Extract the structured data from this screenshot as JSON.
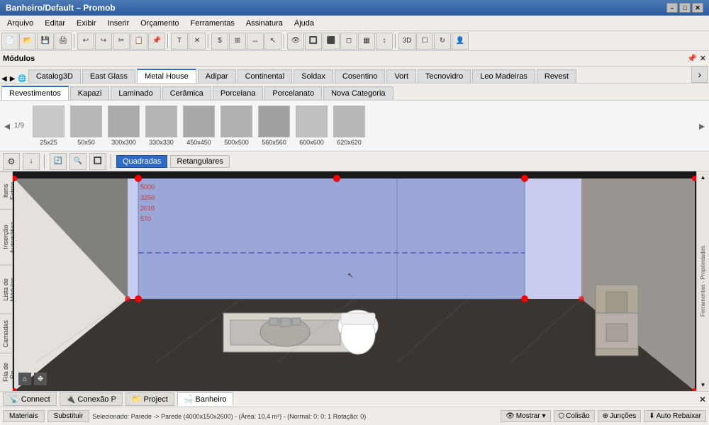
{
  "titleBar": {
    "title": "Banheiro/Default – Promob",
    "buttons": [
      "–",
      "□",
      "✕"
    ]
  },
  "menuBar": {
    "items": [
      "Arquivo",
      "Editar",
      "Exibir",
      "Inserir",
      "Orçamento",
      "Ferramentas",
      "Assinatura",
      "Ajuda"
    ]
  },
  "modulesPanel": {
    "title": "Módulos",
    "pinIcon": "📌",
    "closeIcon": "✕"
  },
  "catalogTabs": {
    "tabs": [
      "Catalog3D",
      "East Glass",
      "Metal House",
      "Adipar",
      "Continental",
      "Soldax",
      "Cosentino",
      "Vort",
      "Tecnovidro",
      "Leo Madeiras",
      "Revest"
    ],
    "activeTab": "Metal House",
    "moreLabel": "›"
  },
  "categoryTabs": {
    "tabs": [
      "Revestimentos",
      "Kapazi",
      "Laminado",
      "Cerâmica",
      "Porcelana",
      "Porcelanato",
      "Nova Categoria"
    ],
    "activeTab": "Revestimentos"
  },
  "tileArea": {
    "pageIndicator": "1/9",
    "tiles": [
      {
        "label": "25x25"
      },
      {
        "label": "50x50"
      },
      {
        "label": "300x300"
      },
      {
        "label": "330x330"
      },
      {
        "label": "450x450"
      },
      {
        "label": "500x500"
      },
      {
        "label": "560x560"
      },
      {
        "label": "600x600"
      },
      {
        "label": "620x620"
      }
    ]
  },
  "filterBar": {
    "buttons": [
      "Quadradas",
      "Retangulares"
    ]
  },
  "verticalTabs": {
    "left": [
      "Itens Extras",
      "Inserção Automática",
      "Lista de Módulos",
      "Camadas",
      "Fila de Re..."
    ]
  },
  "propertiesLabel": "Ferramentas - Propriedades",
  "taskbar": {
    "items": [
      {
        "label": "Connect",
        "icon": "📡"
      },
      {
        "label": "Conexão P",
        "icon": "🔌"
      },
      {
        "label": "Project",
        "icon": "📁"
      },
      {
        "label": "Banheiro",
        "icon": "🛁",
        "active": true
      }
    ],
    "closeLabel": "✕"
  },
  "bottomBar": {
    "items": [
      "Materiais",
      "Substituir"
    ]
  },
  "statusBar": {
    "text": "Selecionado: Parede -> Parede (4000x150x2600) - (Área: 10,4 m²) - (Normal: 0; 0; 1 Rotação: 0)",
    "buttons": [
      "Mostrar ▾",
      "Colisão",
      "Junções",
      "Auto Rebaixar"
    ]
  }
}
